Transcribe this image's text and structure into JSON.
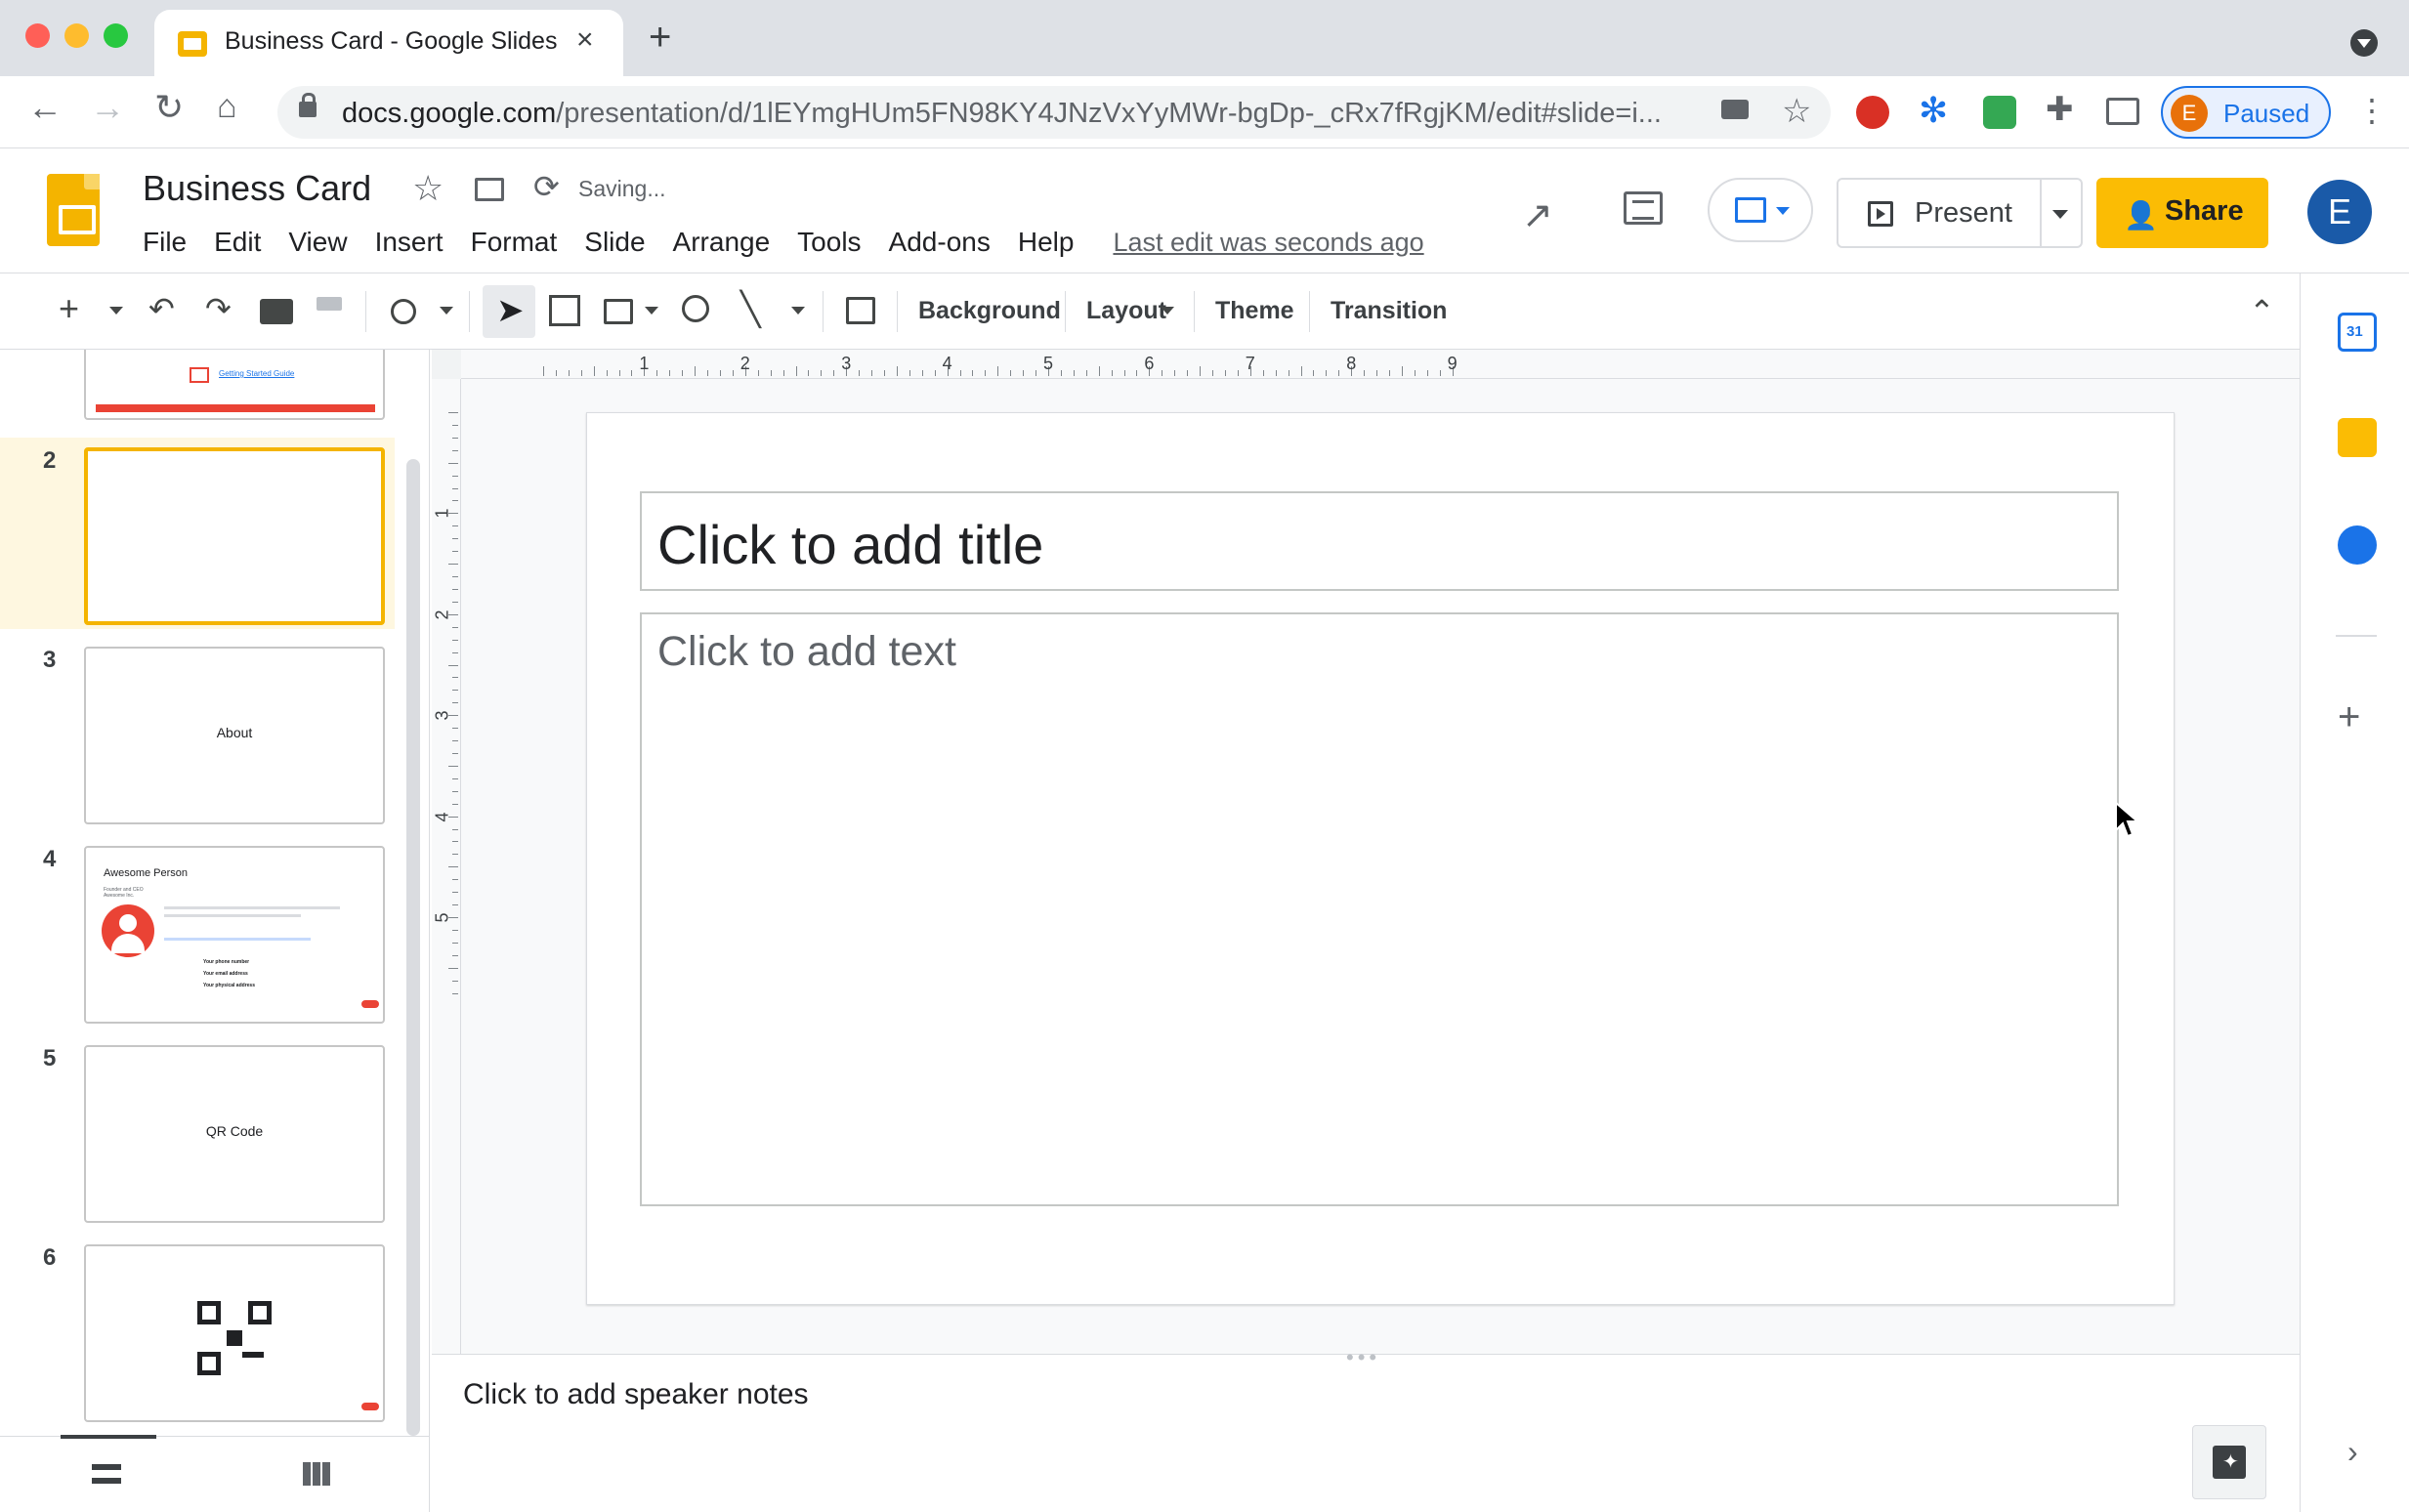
{
  "browser": {
    "tab_title": "Business Card - Google Slides",
    "url_host": "docs.google.com",
    "url_path": "/presentation/d/1lEYmgHUm5FN98KY4JNzVxYyMWr-bgDp-_cRx7fRgjKM/edit#slide=i...",
    "profile_initial": "E",
    "profile_status": "Paused"
  },
  "header": {
    "doc_title": "Business Card",
    "save_status": "Saving...",
    "menu": [
      "File",
      "Edit",
      "View",
      "Insert",
      "Format",
      "Slide",
      "Arrange",
      "Tools",
      "Add-ons",
      "Help"
    ],
    "last_edit": "Last edit was seconds ago",
    "present_label": "Present",
    "share_label": "Share",
    "account_initial": "E"
  },
  "toolbar": {
    "background_label": "Background",
    "layout_label": "Layout",
    "theme_label": "Theme",
    "transition_label": "Transition"
  },
  "filmstrip": {
    "slides": [
      {
        "number": "2",
        "label": ""
      },
      {
        "number": "3",
        "label": "About"
      },
      {
        "number": "4",
        "label": "Awesome Person"
      },
      {
        "number": "5",
        "label": "QR Code"
      },
      {
        "number": "6",
        "label": ""
      }
    ],
    "slide1_link": "Getting Started Guide",
    "slide4_subtitle": "Founder and CEO",
    "slide4_company": "Awesome Inc.",
    "slide4_lines": [
      "Your phone number",
      "Your email address",
      "Your physical address"
    ]
  },
  "canvas": {
    "ruler_h": [
      "1",
      "2",
      "3",
      "4",
      "5",
      "6",
      "7",
      "8",
      "9"
    ],
    "ruler_v": [
      "1",
      "2",
      "3",
      "4",
      "5"
    ],
    "title_placeholder": "Click to add title",
    "body_placeholder": "Click to add text"
  },
  "notes": {
    "placeholder": "Click to add speaker notes"
  },
  "side_panel": {
    "calendar_day": "31"
  },
  "colors": {
    "accent_yellow": "#fbbc04",
    "selected_border": "#f4b400",
    "link_blue": "#1a73e8"
  }
}
